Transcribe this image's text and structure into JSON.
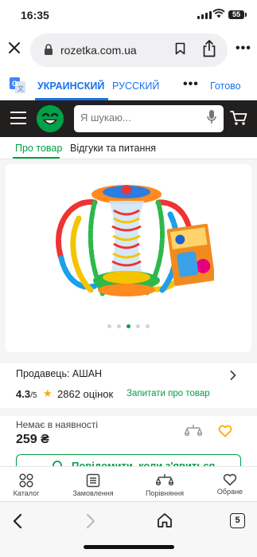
{
  "status_bar": {
    "time": "16:35",
    "battery": "55"
  },
  "browser": {
    "url": "rozetka.com.ua"
  },
  "translate_bar": {
    "active_lang": "УКРАИНСКИЙ",
    "other_lang": "РУССКИЙ",
    "done_label": "Готово"
  },
  "header": {
    "search_placeholder": "Я шукаю..."
  },
  "tabs": [
    {
      "label": "Про товар"
    },
    {
      "label": "Відгуки та питання"
    }
  ],
  "gallery": {
    "slides": 5,
    "active_slide": 3
  },
  "seller": {
    "label": "Продавець: АШАН",
    "rating": "4.3",
    "rating_max": "/5",
    "reviews": "2862 оцінок",
    "ask_label": "Запитати про товар"
  },
  "pricing": {
    "availability": "Немає в наявності",
    "price": "259 ₴",
    "notify_label": "Повідомити, коли з'явиться"
  },
  "bottom_nav": [
    {
      "label": "Каталог",
      "icon": "catalog-icon"
    },
    {
      "label": "Замовлення",
      "icon": "orders-icon"
    },
    {
      "label": "Порівняння",
      "icon": "compare-icon"
    },
    {
      "label": "Обране",
      "icon": "heart-icon"
    }
  ],
  "toolbar": {
    "tab_count": "5"
  },
  "colors": {
    "accent": "#00a046",
    "header_bg": "#221f1f",
    "link_blue": "#1a73e8",
    "star": "#ffa900"
  }
}
